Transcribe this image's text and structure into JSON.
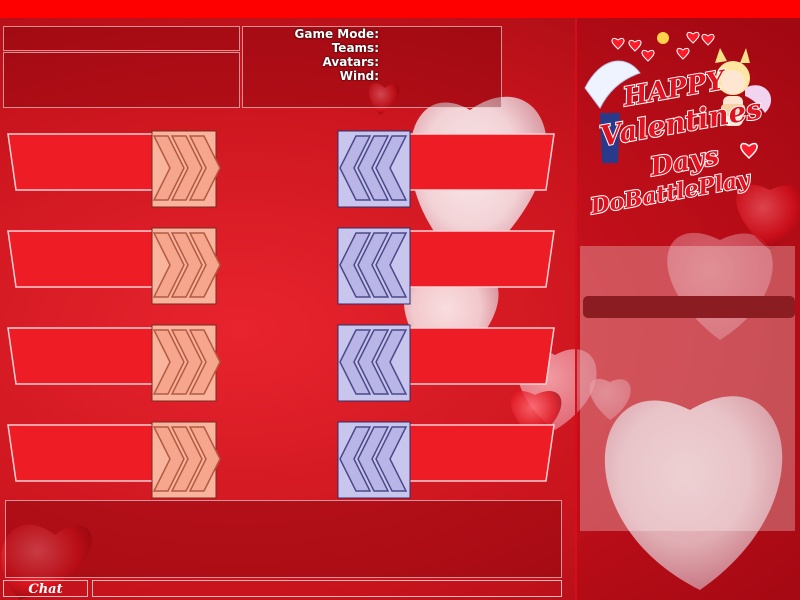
{
  "game_info": {
    "labels": [
      "Game Mode:",
      "Teams:",
      "Avatars:",
      "Wind:"
    ]
  },
  "logo": {
    "line1": "HAPPY",
    "line2": "Valentines",
    "line3": "Days",
    "line4": "DoBattlePlay"
  },
  "chat": {
    "label": "Chat",
    "input_value": ""
  },
  "colors": {
    "background": "#c9141d",
    "top_bar": "#ff0000",
    "team_a_chevron": "#f6a68c",
    "team_b_chevron": "#b9b5e6",
    "slot_bar": "#ee1c25"
  },
  "slots": {
    "team_a": [
      {
        "player": ""
      },
      {
        "player": ""
      },
      {
        "player": ""
      },
      {
        "player": ""
      }
    ],
    "team_b": [
      {
        "player": ""
      },
      {
        "player": ""
      },
      {
        "player": ""
      },
      {
        "player": ""
      }
    ]
  }
}
